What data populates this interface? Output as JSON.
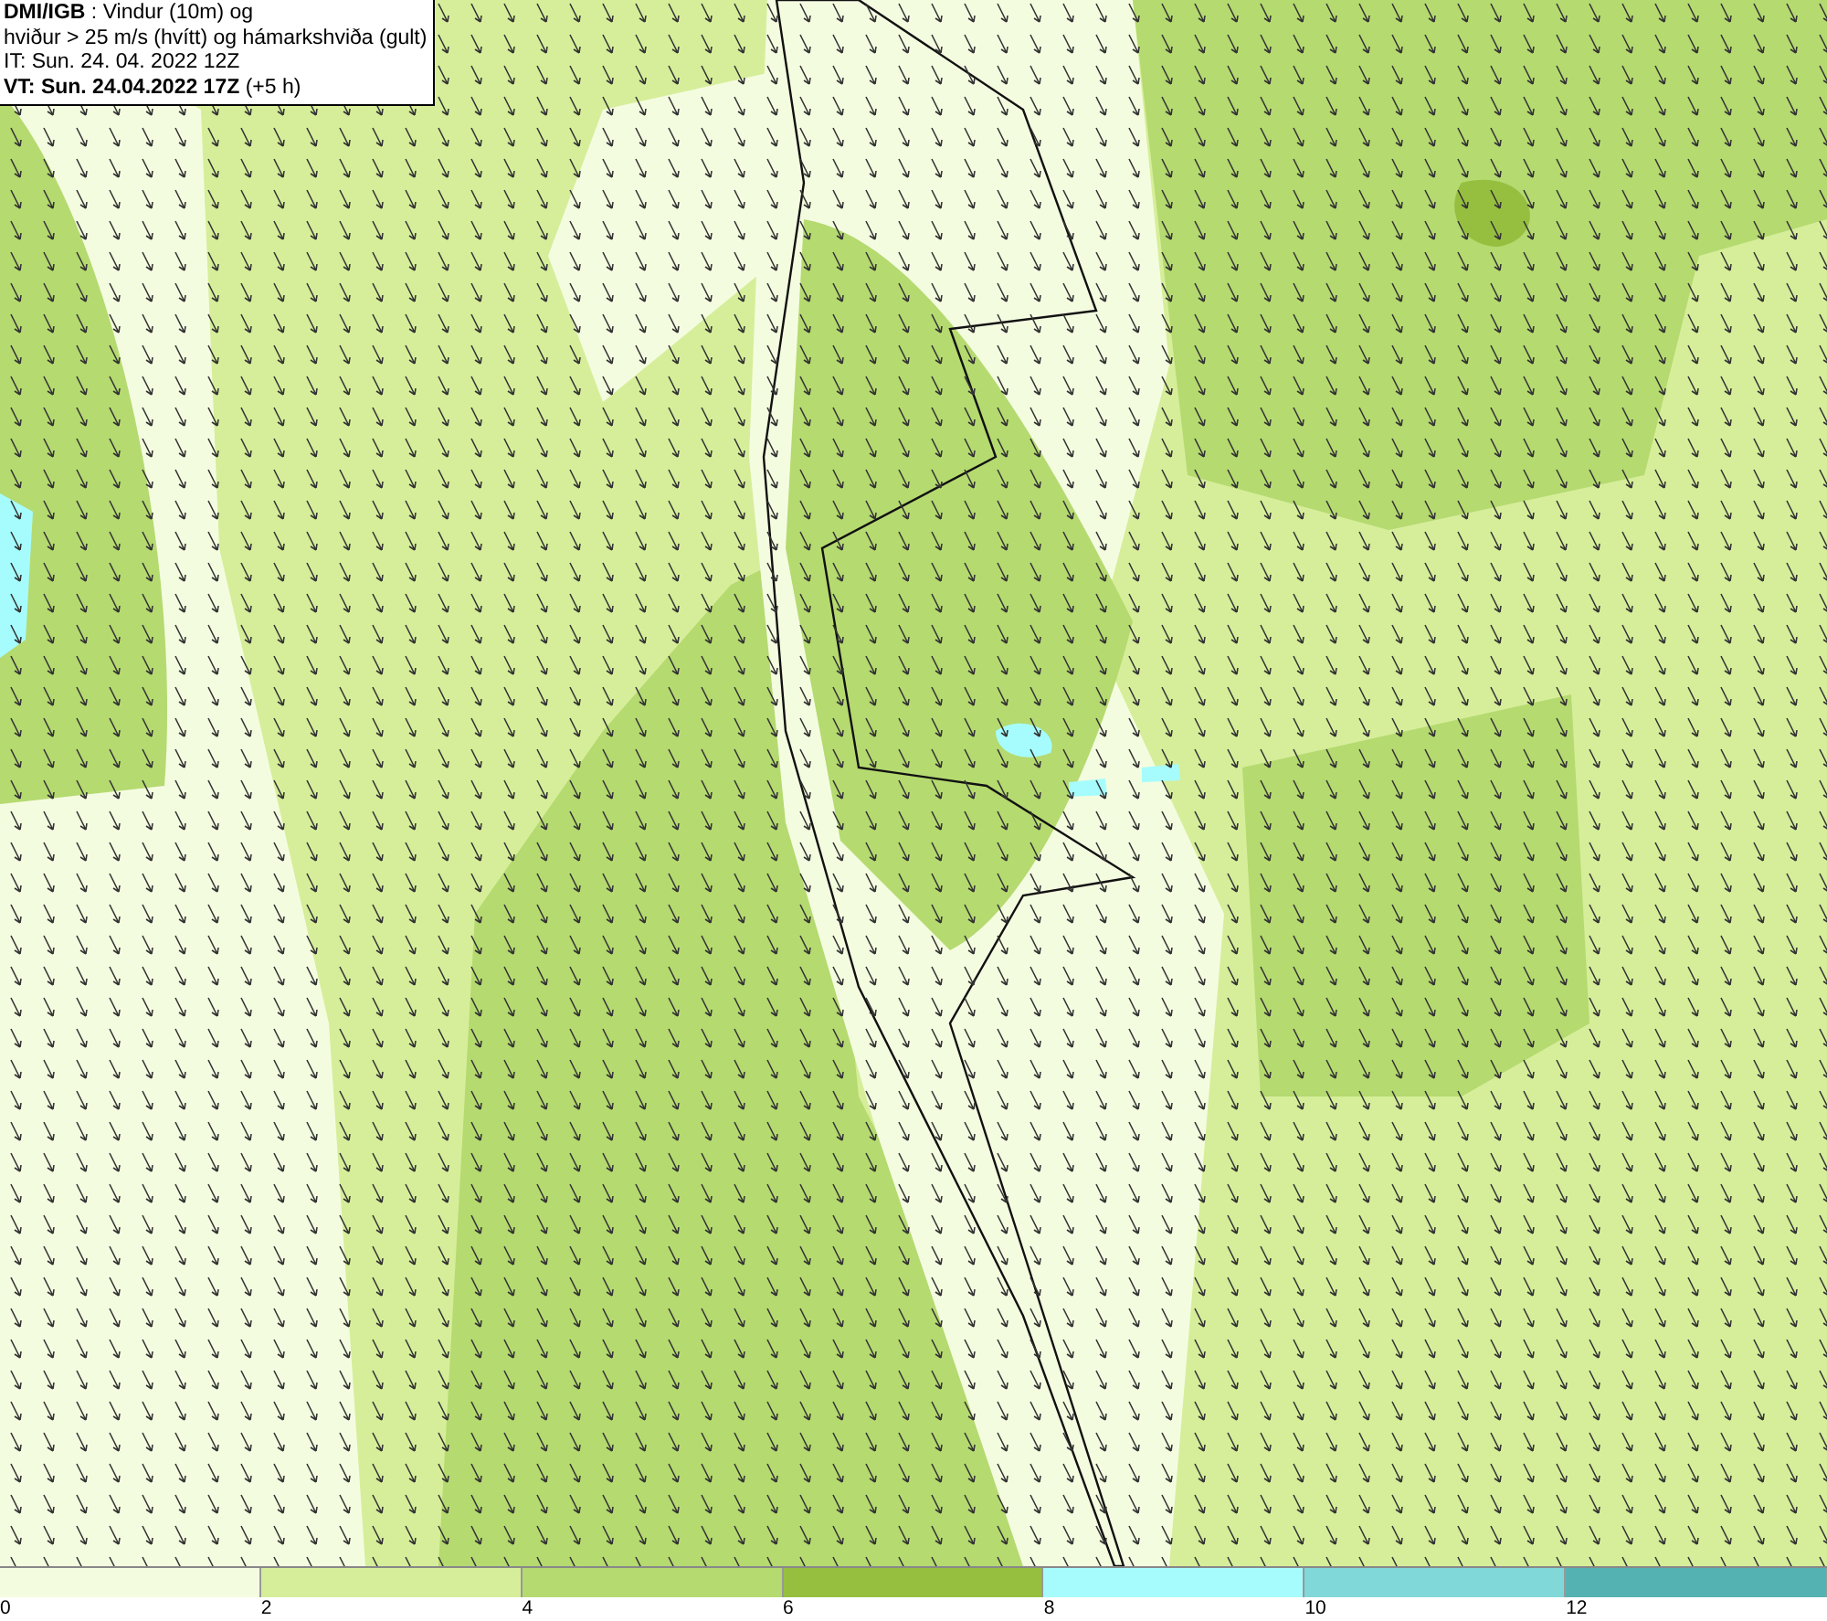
{
  "header": {
    "lines": [
      "**DMI/IGB** : Vindur (10m) og",
      "hviður > 25 m/s (hvítt) og hámarkshviða (gult)",
      "IT: Sun. 24. 04. 2022 12Z",
      "**VT: Sun. 24.04.2022 17Z** (+5 h)"
    ]
  },
  "legend": {
    "segments": [
      {
        "color": "#f4fce0"
      },
      {
        "color": "#d6ee9a"
      },
      {
        "color": "#b5da70"
      },
      {
        "color": "#96bf40"
      },
      {
        "color": "#a6fcfc"
      },
      {
        "color": "#80d8d8"
      },
      {
        "color": "#55b2b2"
      }
    ],
    "ticks": [
      "0",
      "2",
      "4",
      "6",
      "8",
      "10",
      "12"
    ]
  }
}
